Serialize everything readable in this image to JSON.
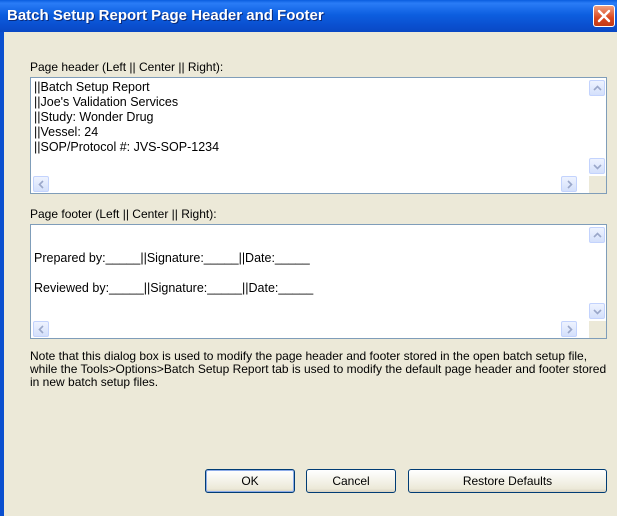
{
  "window": {
    "title": "Batch Setup Report Page Header and Footer"
  },
  "header_section": {
    "label": "Page header (Left || Center || Right):",
    "lines": [
      "||Batch Setup Report",
      "||Joe's Validation Services",
      "||Study: Wonder Drug",
      "||Vessel: 24",
      "||SOP/Protocol #: JVS-SOP-1234"
    ]
  },
  "footer_section": {
    "label": "Page footer (Left || Center || Right):",
    "lines": [
      "Prepared by:_____||Signature:_____||Date:_____",
      "Reviewed by:_____||Signature:_____||Date:_____"
    ]
  },
  "note": "Note that this dialog box is used to modify the page header and footer stored in the open batch setup file, while the Tools>Options>Batch Setup Report tab is used to modify the default page header and footer stored in new batch setup files.",
  "buttons": {
    "ok": "OK",
    "cancel": "Cancel",
    "restore": "Restore Defaults"
  },
  "icons": {
    "close": "close-icon",
    "scroll_up": "arrow-up-icon",
    "scroll_down": "arrow-down-icon",
    "scroll_left": "arrow-left-icon",
    "scroll_right": "arrow-right-icon"
  }
}
